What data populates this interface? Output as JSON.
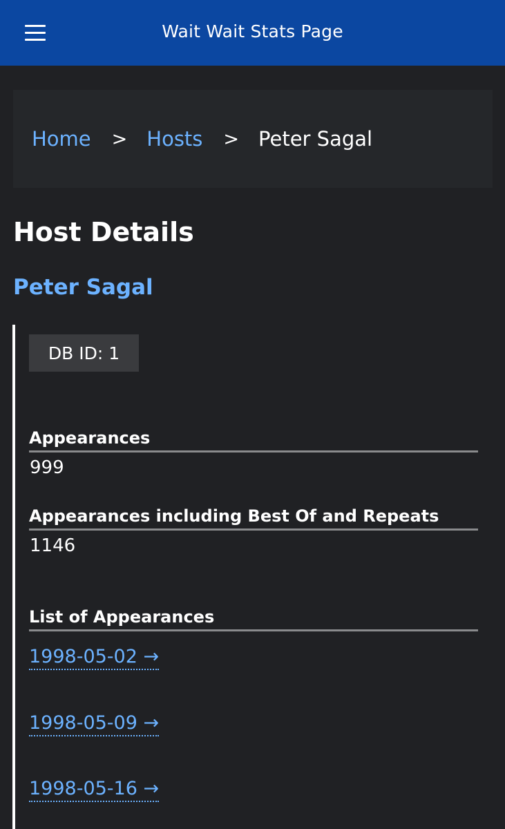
{
  "header": {
    "menu_icon": "hamburger-menu-icon",
    "title": "Wait Wait Stats Page"
  },
  "breadcrumb": {
    "items": [
      {
        "label": "Home"
      },
      {
        "label": "Hosts"
      },
      {
        "label": "Peter Sagal"
      }
    ],
    "separator": ">"
  },
  "main": {
    "page_title": "Host Details",
    "host_name": "Peter Sagal",
    "db_id": "DB ID: 1",
    "appearances": {
      "label": "Appearances",
      "value": "999"
    },
    "appearances_all": {
      "label": "Appearances including Best Of and Repeats",
      "value": "1146"
    },
    "appearance_list": {
      "label": "List of Appearances",
      "items": [
        "1998-05-02 →",
        "1998-05-09 →",
        "1998-05-16 →"
      ]
    }
  },
  "colors": {
    "header_bg": "#0b47a1",
    "page_bg": "#202124",
    "link": "#6cb2ff"
  }
}
